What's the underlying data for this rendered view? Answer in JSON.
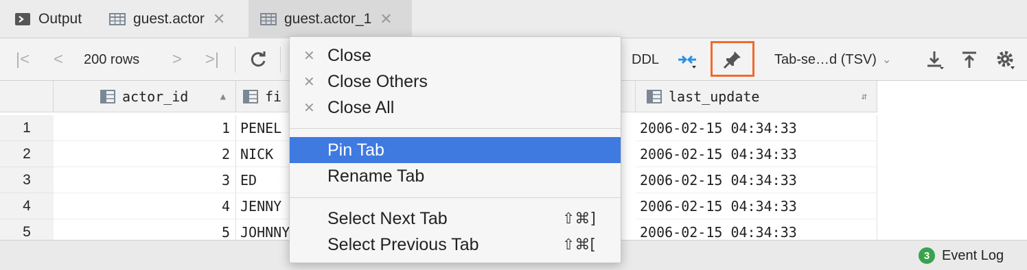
{
  "tabs": [
    {
      "label": "Output",
      "icon": "console-icon",
      "active": false,
      "closable": false
    },
    {
      "label": "guest.actor",
      "icon": "table-icon",
      "active": false,
      "closable": true
    },
    {
      "label": "guest.actor_1",
      "icon": "table-icon",
      "active": true,
      "closable": true
    }
  ],
  "toolbar": {
    "rows_label": "200 rows",
    "ddl_label": "DDL",
    "format_label": "Tab-se…d (TSV)",
    "icons": [
      "first-page-icon",
      "prev-page-icon",
      "next-page-icon",
      "last-page-icon",
      "refresh-icon",
      "compare-icon",
      "pin-icon",
      "download-icon",
      "upload-icon",
      "settings-icon"
    ]
  },
  "grid": {
    "columns": [
      {
        "name": "actor_id"
      },
      {
        "name": "fi"
      },
      {
        "name": "last_update"
      }
    ],
    "rows": [
      {
        "num": "1",
        "actor_id": "1",
        "first_name": "PENEL",
        "last_update": "2006-02-15 04:34:33"
      },
      {
        "num": "2",
        "actor_id": "2",
        "first_name": "NICK",
        "last_update": "2006-02-15 04:34:33"
      },
      {
        "num": "3",
        "actor_id": "3",
        "first_name": "ED",
        "last_update": "2006-02-15 04:34:33"
      },
      {
        "num": "4",
        "actor_id": "4",
        "first_name": "JENNY",
        "last_update": "2006-02-15 04:34:33"
      },
      {
        "num": "5",
        "actor_id": "5",
        "first_name": "JOHNNY",
        "last_update": "2006-02-15 04:34:33"
      }
    ]
  },
  "context_menu": {
    "items": [
      {
        "label": "Close",
        "closeIcon": true
      },
      {
        "label": "Close Others",
        "closeIcon": true
      },
      {
        "label": "Close All",
        "closeIcon": true
      },
      {
        "label": "Pin Tab",
        "selected": true
      },
      {
        "label": "Rename Tab"
      },
      {
        "label": "Select Next Tab",
        "shortcut": "⇧⌘]"
      },
      {
        "label": "Select Previous Tab",
        "shortcut": "⇧⌘["
      }
    ]
  },
  "statusbar": {
    "event_log_label": "Event Log",
    "event_count": "3"
  },
  "colors": {
    "accent": "#3e7ae0",
    "highlight_border": "#ee6a2d",
    "badge": "#3aa24f",
    "compare_icon": "#2f8fdf"
  }
}
